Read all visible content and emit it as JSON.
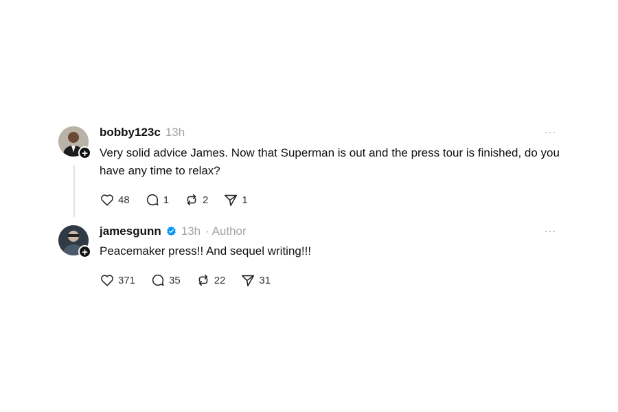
{
  "posts": [
    {
      "username": "bobby123c",
      "time": "13h",
      "text": "Very solid advice James. Now that Superman is out and the press tour is finished, do you have any time to relax?",
      "likes": "48",
      "replies": "1",
      "reposts": "2",
      "shares": "1",
      "more": "···"
    },
    {
      "username": "jamesgunn",
      "time": "13h",
      "author_label": "· Author",
      "text": "Peacemaker press!! And sequel writing!!!",
      "likes": "371",
      "replies": "35",
      "reposts": "22",
      "shares": "31",
      "more": "···"
    }
  ],
  "colors": {
    "verified": "#0095f6",
    "muted": "#a3a3a3"
  },
  "icons": {
    "like": "heart-icon",
    "reply": "comment-icon",
    "repost": "repost-icon",
    "share": "send-icon",
    "follow": "plus-icon"
  }
}
